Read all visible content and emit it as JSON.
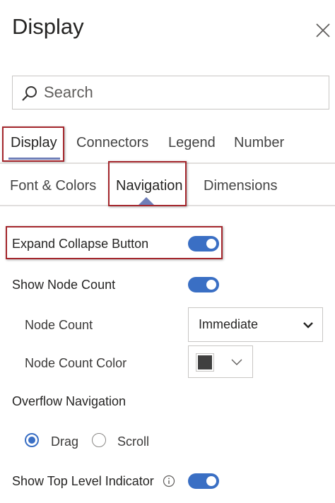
{
  "header": {
    "title": "Display"
  },
  "search": {
    "placeholder": "Search",
    "value": ""
  },
  "tabs": {
    "row1": [
      {
        "label": "Display",
        "selected": true
      },
      {
        "label": "Connectors"
      },
      {
        "label": "Legend"
      },
      {
        "label": "Number"
      }
    ],
    "row2": [
      {
        "label": "Font & Colors"
      },
      {
        "label": "Navigation",
        "selected": true
      },
      {
        "label": "Dimensions"
      }
    ]
  },
  "settings": {
    "expand_collapse": {
      "label": "Expand Collapse Button",
      "on": true
    },
    "show_node_count": {
      "label": "Show Node Count",
      "on": true
    },
    "node_count": {
      "label": "Node Count",
      "value": "Immediate"
    },
    "node_count_color": {
      "label": "Node Count Color",
      "color": "#404040"
    },
    "overflow_navigation": {
      "label": "Overflow Navigation",
      "options": [
        {
          "label": "Drag",
          "selected": true
        },
        {
          "label": "Scroll",
          "selected": false
        }
      ]
    },
    "show_top_level_indicator": {
      "label": "Show Top Level Indicator",
      "on": true
    }
  },
  "icons": {
    "close": "close-icon",
    "search": "search-icon",
    "dropdown": "chevron-down-icon",
    "info": "info-icon"
  },
  "colors": {
    "accent": "#3a6fc4",
    "highlight_box": "#a4262c",
    "tab_underline": "#6f7fb8"
  }
}
